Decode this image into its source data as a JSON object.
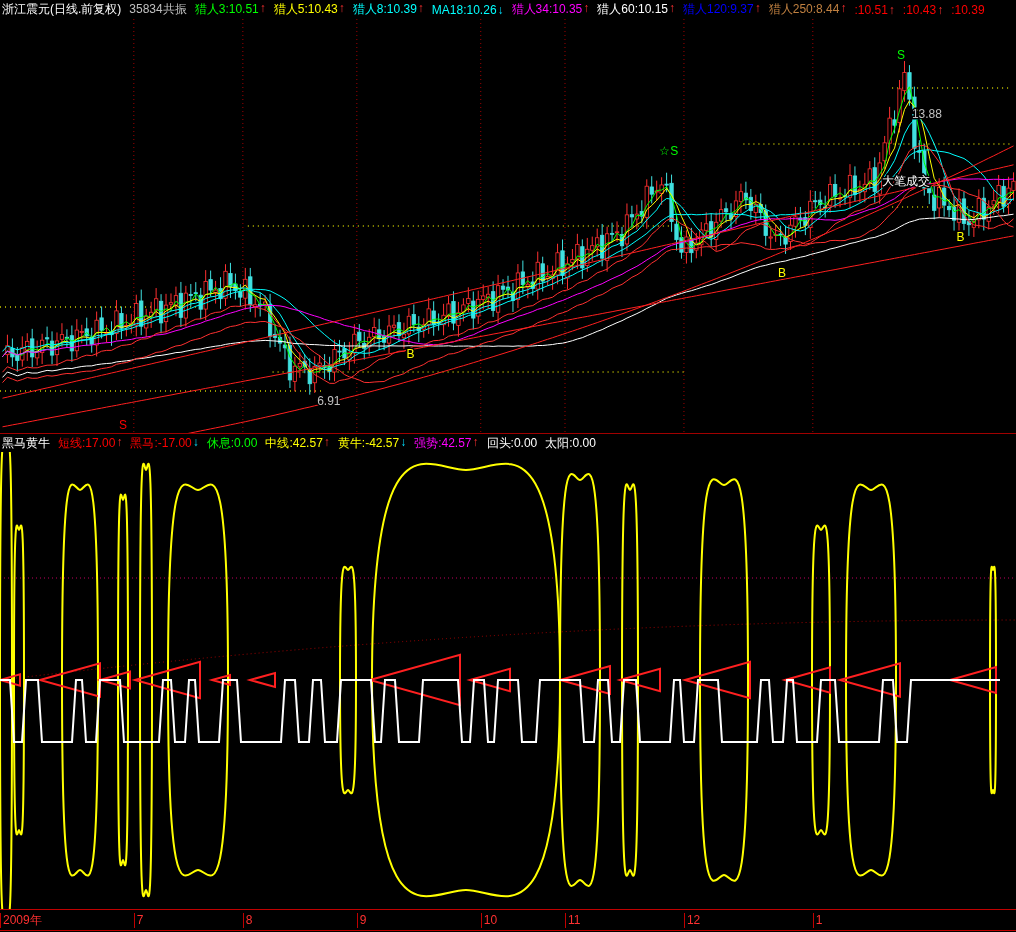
{
  "main_panel": {
    "title": "浙江震元(日线.前复权)",
    "signal": "35834共振",
    "legend": [
      {
        "label": "猎人3:10.51",
        "color": "#00ff00",
        "kind": "up",
        "arrow": "↑"
      },
      {
        "label": "猎人5:10.43",
        "color": "#ffff00",
        "kind": "up",
        "arrow": "↑"
      },
      {
        "label": "猎人8:10.39",
        "color": "#00ffff",
        "kind": "up",
        "arrow": "↑"
      },
      {
        "label": "MA18:10.26",
        "color": "#00ffff",
        "kind": "down",
        "arrow": "↓"
      },
      {
        "label": "猎人34:10.35",
        "color": "#ff00ff",
        "kind": "up",
        "arrow": "↑"
      },
      {
        "label": "猎人60:10.15",
        "color": "#ffffff",
        "kind": "up",
        "arrow": "↑"
      },
      {
        "label": "猎人120:9.37",
        "color": "#0000ff",
        "kind": "up",
        "arrow": "↑"
      },
      {
        "label": "猎人250:8.44",
        "color": "#c08040",
        "kind": "up",
        "arrow": "↑"
      },
      {
        "label": ":10.51",
        "color": "#ff0000",
        "kind": "up",
        "arrow": "↑"
      },
      {
        "label": ":10.43",
        "color": "#ff0000",
        "kind": "up",
        "arrow": "↑"
      },
      {
        "label": ":10.39",
        "color": "#ff0000",
        "kind": "plain"
      }
    ],
    "annotations": [
      {
        "text": "S",
        "color": "#00ff00"
      },
      {
        "text": "13.88",
        "color": "#c0c0c0"
      },
      {
        "text": "☆S",
        "color": "#00ff00"
      },
      {
        "text": "大笔成交",
        "color": "#ffffff"
      },
      {
        "text": "B",
        "color": "#ffff00"
      },
      {
        "text": "B",
        "color": "#ffff00"
      },
      {
        "text": "B",
        "color": "#ffff00"
      },
      {
        "text": "6.91",
        "color": "#c0c0c0"
      },
      {
        "text": "S",
        "color": "#ff0000"
      }
    ]
  },
  "indicator_panel": {
    "title": "黑马黄牛",
    "legend": [
      {
        "label": "短线:17.00",
        "color": "#ff0000",
        "kind": "up",
        "arrow": "↑"
      },
      {
        "label": "黑马:-17.00",
        "color": "#ff0000",
        "kind": "down",
        "arrow": "↓"
      },
      {
        "label": "休息:0.00",
        "color": "#00ff00",
        "kind": "plain"
      },
      {
        "label": "中线:42.57",
        "color": "#ffff00",
        "kind": "up",
        "arrow": "↑"
      },
      {
        "label": "黄牛:-42.57",
        "color": "#ffff00",
        "kind": "down",
        "arrow": "↓"
      },
      {
        "label": "强势:42.57",
        "color": "#ff00ff",
        "kind": "up",
        "arrow": "↑"
      },
      {
        "label": "回头:0.00",
        "color": "#ffffff",
        "kind": "plain"
      },
      {
        "label": "太阳:0.00",
        "color": "#ffffff",
        "kind": "plain"
      }
    ]
  },
  "time_axis": [
    "2009年",
    "7",
    "8",
    "9",
    "10",
    "11",
    "12",
    "1"
  ]
}
